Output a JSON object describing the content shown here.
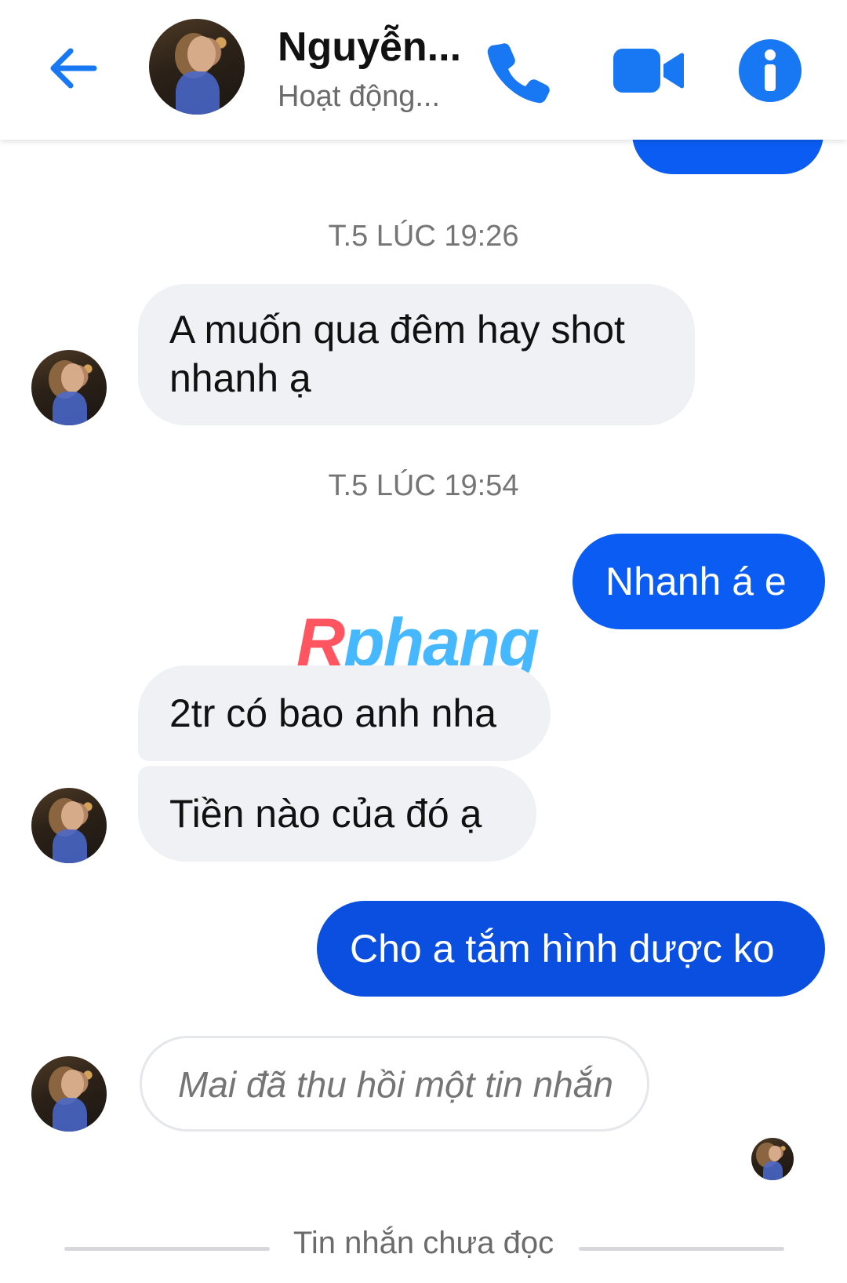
{
  "header": {
    "contact_name": "Nguyễn...",
    "contact_status": "Hoạt động...",
    "icons": {
      "back": "back-arrow-icon",
      "phone": "phone-icon",
      "video": "video-camera-icon",
      "info": "info-icon"
    },
    "accent_color": "#1877f2"
  },
  "timestamps": [
    "T.5 LÚC 19:26",
    "T.5 LÚC 19:54"
  ],
  "messages": {
    "incoming_1": "A muốn qua đêm hay shot nhanh ạ",
    "outgoing_1": "Nhanh á e",
    "incoming_2": "2tr có bao anh nha",
    "incoming_3": "Tiền nào của đó ạ",
    "outgoing_2": "Cho a tắm hình dược ko",
    "retracted_notice": "Mai đã thu hồi một tin nhắn"
  },
  "watermark": {
    "first": "R",
    "rest": "phang"
  },
  "unread_divider": "Tin nhắn chưa đọc",
  "colors": {
    "outgoing_bubble": "#0a5cf2",
    "incoming_bubble": "#eff1f5",
    "timestamp_text": "#757575"
  }
}
